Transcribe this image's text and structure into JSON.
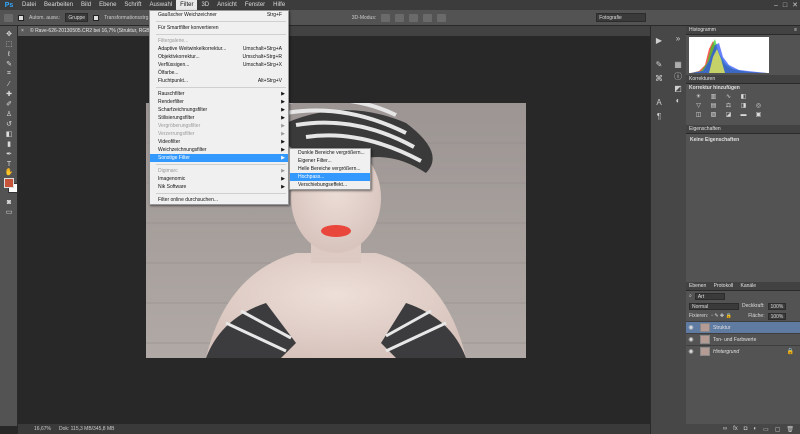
{
  "menubar": {
    "logo": "Ps",
    "items": [
      "Datei",
      "Bearbeiten",
      "Bild",
      "Ebene",
      "Schrift",
      "Auswahl",
      "Filter",
      "3D",
      "Ansicht",
      "Fenster",
      "Hilfe"
    ],
    "active": "Filter",
    "window_controls": [
      "–",
      "□",
      "✕"
    ]
  },
  "optionsbar": {
    "auto_select_label": "Autom. ausw.:",
    "auto_select_value": "Gruppe",
    "transform_label": "Transformationsstrg.",
    "mode_3d_label": "3D-Modus:",
    "workspace": "Fotografie"
  },
  "document": {
    "tab_title": "© Rave-626-20130505.CR2 bei 16,7% (Struktur, RGB/8)"
  },
  "filter_menu": {
    "items": [
      {
        "label": "Gaußscher Weichzeichner",
        "shortcut": "Strg+F"
      },
      {
        "sep": true
      },
      {
        "label": "Für Smartfilter konvertieren"
      },
      {
        "sep": true
      },
      {
        "label": "Filtergalerie...",
        "disabled": true
      },
      {
        "label": "Adaptive Weitwinkelkorrektur...",
        "shortcut": "Umschalt+Strg+A"
      },
      {
        "label": "Objektivkorrektur...",
        "shortcut": "Umschalt+Strg+R"
      },
      {
        "label": "Verflüssigen...",
        "shortcut": "Umschalt+Strg+X"
      },
      {
        "label": "Ölfarbe..."
      },
      {
        "label": "Fluchtpunkt...",
        "shortcut": "Alt+Strg+V"
      },
      {
        "sep": true
      },
      {
        "label": "Rauschfilter",
        "sub": true
      },
      {
        "label": "Renderfilter",
        "sub": true
      },
      {
        "label": "Scharfzeichnungsfilter",
        "sub": true
      },
      {
        "label": "Stilisierungsfilter",
        "sub": true
      },
      {
        "label": "Vergröberungsfilter",
        "sub": true,
        "disabled": true
      },
      {
        "label": "Verzerrungsfilter",
        "sub": true,
        "disabled": true
      },
      {
        "label": "Videofilter",
        "sub": true
      },
      {
        "label": "Weichzeichnungsfilter",
        "sub": true
      },
      {
        "label": "Sonstige Filter",
        "sub": true,
        "highlight": true
      },
      {
        "sep": true
      },
      {
        "label": "Digimarc",
        "sub": true,
        "disabled": true
      },
      {
        "label": "Imagenomic",
        "sub": true
      },
      {
        "label": "Nik Software",
        "sub": true
      },
      {
        "sep": true
      },
      {
        "label": "Filter online durchsuchen..."
      }
    ]
  },
  "submenu": {
    "items": [
      {
        "label": "Dunkle Bereiche vergrößern..."
      },
      {
        "label": "Eigener Filter..."
      },
      {
        "label": "Helle Bereiche vergrößern..."
      },
      {
        "label": "Hochpass...",
        "highlight": true
      },
      {
        "label": "Verschiebungseffekt..."
      }
    ]
  },
  "panels": {
    "histogram_tab": "Histogramm",
    "adjustments_tab": "Korrekturen",
    "adjustments_subtitle": "Korrektur hinzufügen",
    "properties_tab": "Eigenschaften",
    "properties_body": "Keine Eigenschaften",
    "layers_tabs": [
      "Ebenen",
      "Protokoll",
      "Kanäle"
    ],
    "filter_kind": "Art",
    "blend_mode": "Normal",
    "opacity_label": "Deckkraft:",
    "opacity_value": "100%",
    "lock_label": "Fixieren:",
    "fill_label": "Fläche:",
    "fill_value": "100%",
    "layers": [
      {
        "name": "Struktur",
        "selected": true
      },
      {
        "name": "Ton- und Farbwerte"
      },
      {
        "name": "Hintergrund",
        "locked": true
      }
    ]
  },
  "status": {
    "zoom": "16,67%",
    "doc_size": "Dok: 115,3 MB/345,8 MB"
  },
  "colors": {
    "foreground": "#c5543b",
    "background": "#ffffff",
    "highlight": "#3399ff"
  }
}
